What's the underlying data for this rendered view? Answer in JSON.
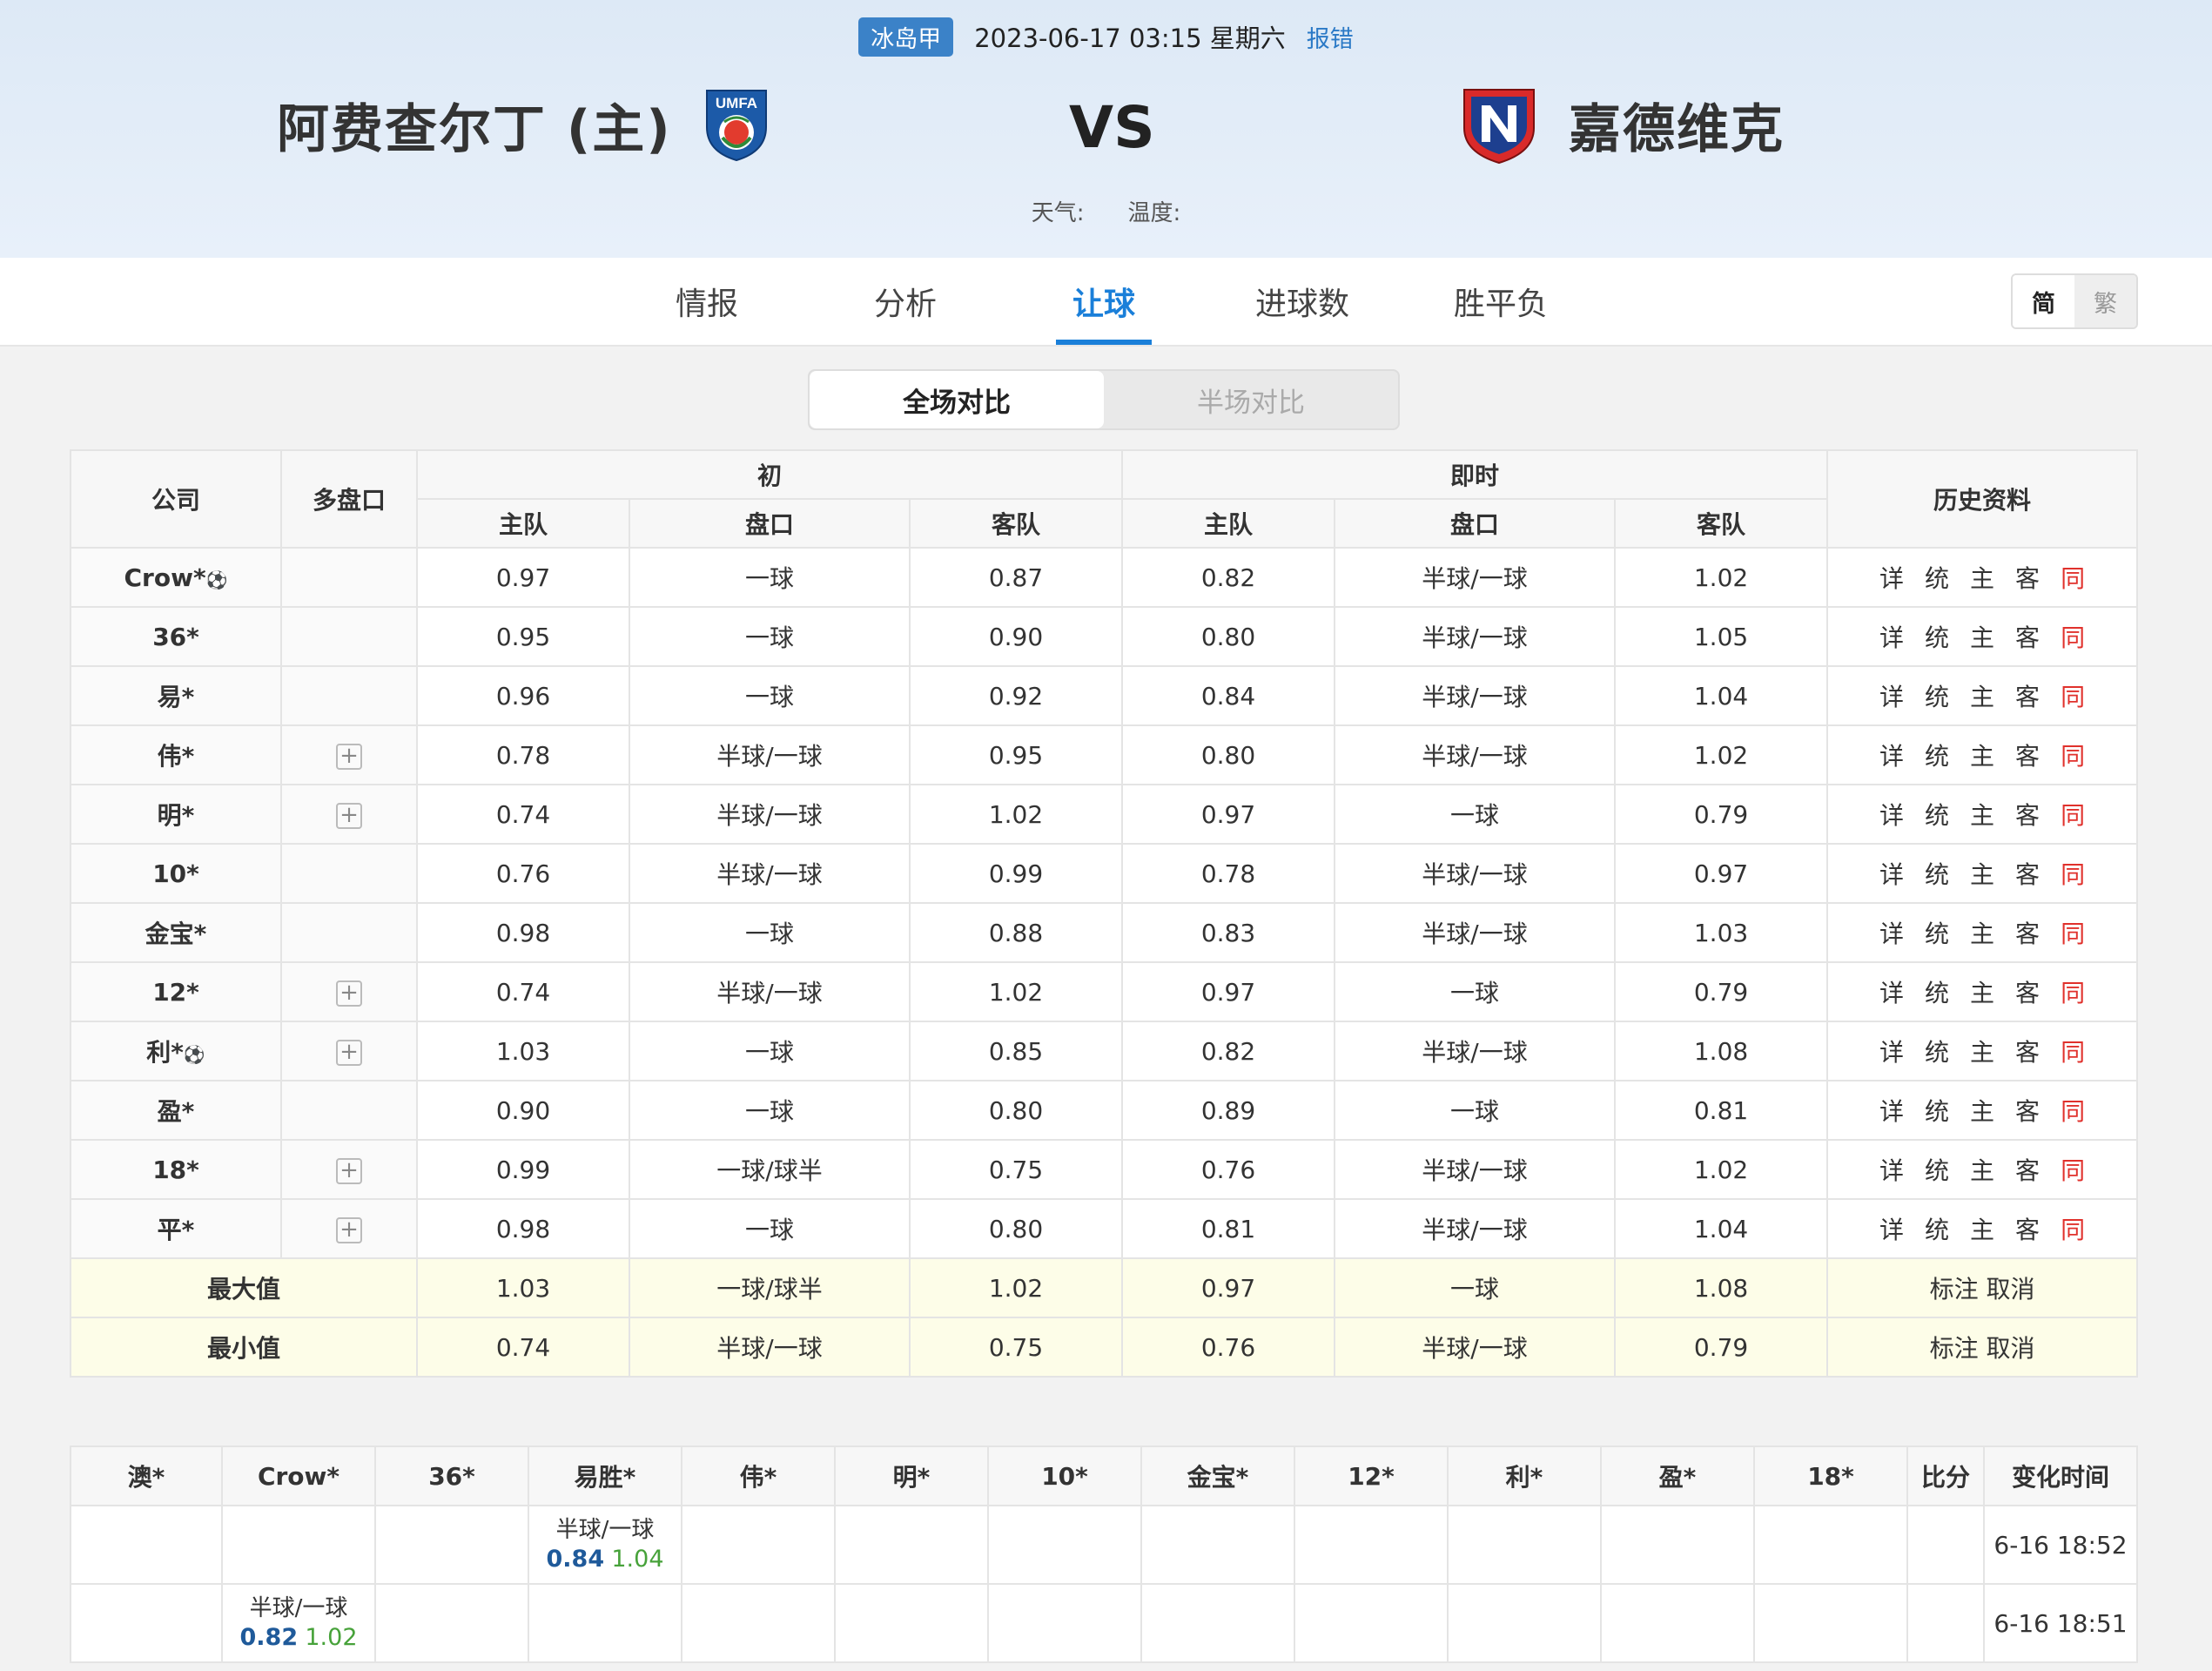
{
  "match": {
    "league": "冰岛甲",
    "datetime": "2023-06-17 03:15 星期六",
    "report": "报错",
    "home_team": "阿费查尔丁 (主)",
    "vs": "VS",
    "away_team": "嘉德维克",
    "weather_label": "天气:",
    "temp_label": "温度:",
    "home_logo_text": "UMFA"
  },
  "tabs": [
    "情报",
    "分析",
    "让球",
    "进球数",
    "胜平负"
  ],
  "active_tab": "让球",
  "lang": {
    "simplified": "简",
    "traditional": "繁"
  },
  "segment": {
    "full": "全场对比",
    "half": "半场对比"
  },
  "odds_table": {
    "headers": {
      "company": "公司",
      "multi": "多盘口",
      "initial": "初",
      "live": "即时",
      "history": "历史资料",
      "home": "主队",
      "line": "盘口",
      "away": "客队"
    },
    "history_links": [
      "详",
      "统",
      "主",
      "客",
      "同"
    ],
    "rows": [
      {
        "company": "Crow*",
        "ball": true,
        "multi": false,
        "i_home": "0.97",
        "i_line": "一球",
        "i_away": "0.87",
        "l_home": "0.82",
        "l_line": "半球/一球",
        "l_away": "1.02"
      },
      {
        "company": "36*",
        "ball": false,
        "multi": false,
        "i_home": "0.95",
        "i_line": "一球",
        "i_away": "0.90",
        "l_home": "0.80",
        "l_line": "半球/一球",
        "l_away": "1.05"
      },
      {
        "company": "易*",
        "ball": false,
        "multi": false,
        "i_home": "0.96",
        "i_line": "一球",
        "i_away": "0.92",
        "l_home": "0.84",
        "l_line": "半球/一球",
        "l_away": "1.04"
      },
      {
        "company": "伟*",
        "ball": false,
        "multi": true,
        "i_home": "0.78",
        "i_line": "半球/一球",
        "i_away": "0.95",
        "l_home": "0.80",
        "l_line": "半球/一球",
        "l_away": "1.02"
      },
      {
        "company": "明*",
        "ball": false,
        "multi": true,
        "i_home": "0.74",
        "i_line": "半球/一球",
        "i_away": "1.02",
        "l_home": "0.97",
        "l_line": "一球",
        "l_away": "0.79"
      },
      {
        "company": "10*",
        "ball": false,
        "multi": false,
        "i_home": "0.76",
        "i_line": "半球/一球",
        "i_away": "0.99",
        "l_home": "0.78",
        "l_line": "半球/一球",
        "l_away": "0.97"
      },
      {
        "company": "金宝*",
        "ball": false,
        "multi": false,
        "i_home": "0.98",
        "i_line": "一球",
        "i_away": "0.88",
        "l_home": "0.83",
        "l_line": "半球/一球",
        "l_away": "1.03"
      },
      {
        "company": "12*",
        "ball": false,
        "multi": true,
        "i_home": "0.74",
        "i_line": "半球/一球",
        "i_away": "1.02",
        "l_home": "0.97",
        "l_line": "一球",
        "l_away": "0.79"
      },
      {
        "company": "利*",
        "ball": true,
        "multi": true,
        "i_home": "1.03",
        "i_line": "一球",
        "i_away": "0.85",
        "l_home": "0.82",
        "l_line": "半球/一球",
        "l_away": "1.08"
      },
      {
        "company": "盈*",
        "ball": false,
        "multi": false,
        "i_home": "0.90",
        "i_line": "一球",
        "i_away": "0.80",
        "l_home": "0.89",
        "l_line": "一球",
        "l_away": "0.81"
      },
      {
        "company": "18*",
        "ball": false,
        "multi": true,
        "i_home": "0.99",
        "i_line": "一球/球半",
        "i_away": "0.75",
        "l_home": "0.76",
        "l_line": "半球/一球",
        "l_away": "1.02"
      },
      {
        "company": "平*",
        "ball": false,
        "multi": true,
        "i_home": "0.98",
        "i_line": "一球",
        "i_away": "0.80",
        "l_home": "0.81",
        "l_line": "半球/一球",
        "l_away": "1.04"
      }
    ],
    "summary": [
      {
        "label": "最大值",
        "i_home": "1.03",
        "i_line": "一球/球半",
        "i_away": "1.02",
        "l_home": "0.97",
        "l_line": "一球",
        "l_away": "1.08",
        "mark": "标注",
        "cancel": "取消"
      },
      {
        "label": "最小值",
        "i_home": "0.74",
        "i_line": "半球/一球",
        "i_away": "0.75",
        "l_home": "0.76",
        "l_line": "半球/一球",
        "l_away": "0.79",
        "mark": "标注",
        "cancel": "取消"
      }
    ]
  },
  "change_table": {
    "headers": [
      "澳*",
      "Crow*",
      "36*",
      "易胜*",
      "伟*",
      "明*",
      "10*",
      "金宝*",
      "12*",
      "利*",
      "盈*",
      "18*",
      "比分",
      "变化时间"
    ],
    "rows": [
      {
        "cells": [
          null,
          null,
          null,
          {
            "line": "半球/一球",
            "home": "0.84",
            "away": "1.04"
          },
          null,
          null,
          null,
          null,
          null,
          null,
          null,
          null,
          ""
        ],
        "time": "6-16 18:52"
      },
      {
        "cells": [
          null,
          {
            "line": "半球/一球",
            "home": "0.82",
            "away": "1.02"
          },
          null,
          null,
          null,
          null,
          null,
          null,
          null,
          null,
          null,
          null,
          ""
        ],
        "time": "6-16 18:51"
      }
    ]
  }
}
